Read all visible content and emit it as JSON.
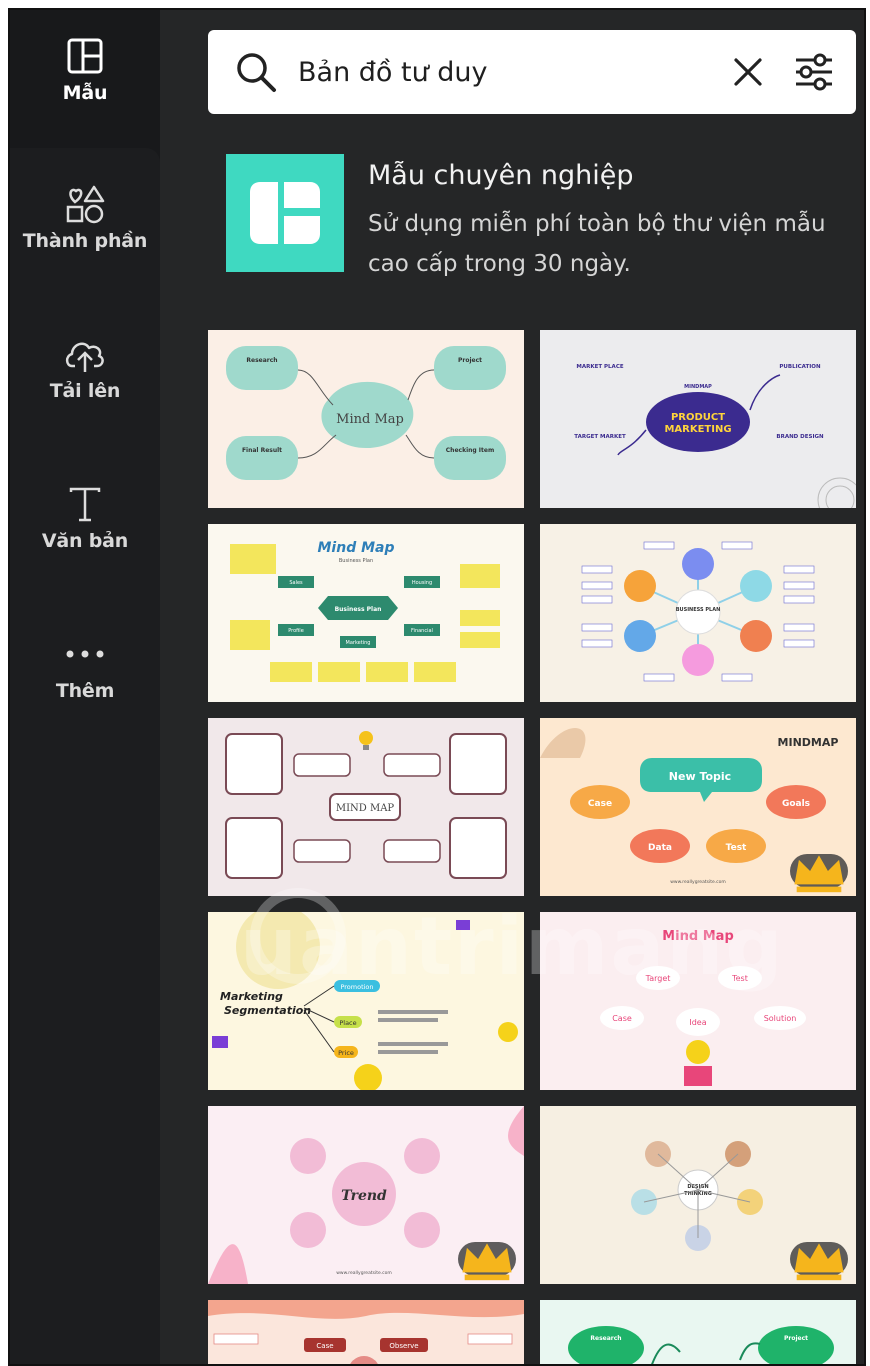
{
  "rail": {
    "items": [
      {
        "label": "Mẫu",
        "icon": "templates-icon",
        "active": true
      },
      {
        "label": "Thành phần",
        "icon": "elements-icon",
        "active": false
      },
      {
        "label": "Tải lên",
        "icon": "upload-cloud-icon",
        "active": false
      },
      {
        "label": "Văn bản",
        "icon": "text-icon",
        "active": false
      },
      {
        "label": "Thêm",
        "icon": "more-dots-icon",
        "active": false
      }
    ]
  },
  "search": {
    "value": "Bản đồ tư duy",
    "icon": "search-icon",
    "clear_icon": "close-icon",
    "filter_icon": "filter-sliders-icon"
  },
  "promo": {
    "title": "Mẫu chuyên nghiệp",
    "description": "Sử dụng miễn phí toàn bộ thư viện mẫu cao cấp trong 30 ngày.",
    "logo_color": "#3fd9c1"
  },
  "templates": [
    {
      "name": "mindmap-pastel",
      "texts": {
        "center": "Mind Map",
        "a": "Research",
        "b": "Project",
        "c": "Final Result",
        "d": "Checking Item"
      },
      "premium": false
    },
    {
      "name": "product-marketing",
      "texts": {
        "center1": "PRODUCT",
        "center2": "MARKETING",
        "kicker": "MINDMAP",
        "a": "MARKET PLACE",
        "b": "PUBLICATION",
        "c": "TARGET MARKET",
        "d": "BRAND DESIGN"
      },
      "premium": false
    },
    {
      "name": "business-plan",
      "texts": {
        "title": "Mind Map",
        "subtitle": "Business Plan",
        "center": "Business Plan",
        "a": "Sales",
        "b": "Housing",
        "c": "Profile",
        "d": "Financial",
        "e": "Marketing"
      },
      "premium": false
    },
    {
      "name": "business-plan-circles",
      "texts": {
        "center": "BUSINESS PLAN"
      },
      "premium": false
    },
    {
      "name": "sketch-mindmap",
      "texts": {
        "center": "MIND MAP"
      },
      "premium": false
    },
    {
      "name": "new-topic-clouds",
      "texts": {
        "header": "MINDMAP",
        "center": "New Topic",
        "a": "Case",
        "b": "Goals",
        "c": "Data",
        "d": "Test",
        "url": "www.reallygreatsite.com"
      },
      "premium": true
    },
    {
      "name": "marketing-segmentation",
      "texts": {
        "title1": "Marketing",
        "title2": "Segmentation",
        "a": "Promotion",
        "b": "Place",
        "c": "Price"
      },
      "premium": false
    },
    {
      "name": "idea-mindmap",
      "texts": {
        "title": "Mind Map",
        "center": "Idea",
        "a": "Target",
        "b": "Test",
        "c": "Case",
        "d": "Solution"
      },
      "premium": false
    },
    {
      "name": "trend-watercolor",
      "texts": {
        "center": "Trend",
        "url": "www.reallygreatsite.com"
      },
      "premium": true
    },
    {
      "name": "design-thinking",
      "texts": {
        "center1": "DESIGN",
        "center2": "THINKING"
      },
      "premium": true
    },
    {
      "name": "case-observe",
      "texts": {
        "a": "Case",
        "b": "Observe"
      },
      "premium": false
    },
    {
      "name": "research-project-green",
      "texts": {
        "a": "Research",
        "b": "Project"
      },
      "premium": false
    }
  ],
  "watermark": "uantrimang",
  "crown_icon": "crown-icon"
}
